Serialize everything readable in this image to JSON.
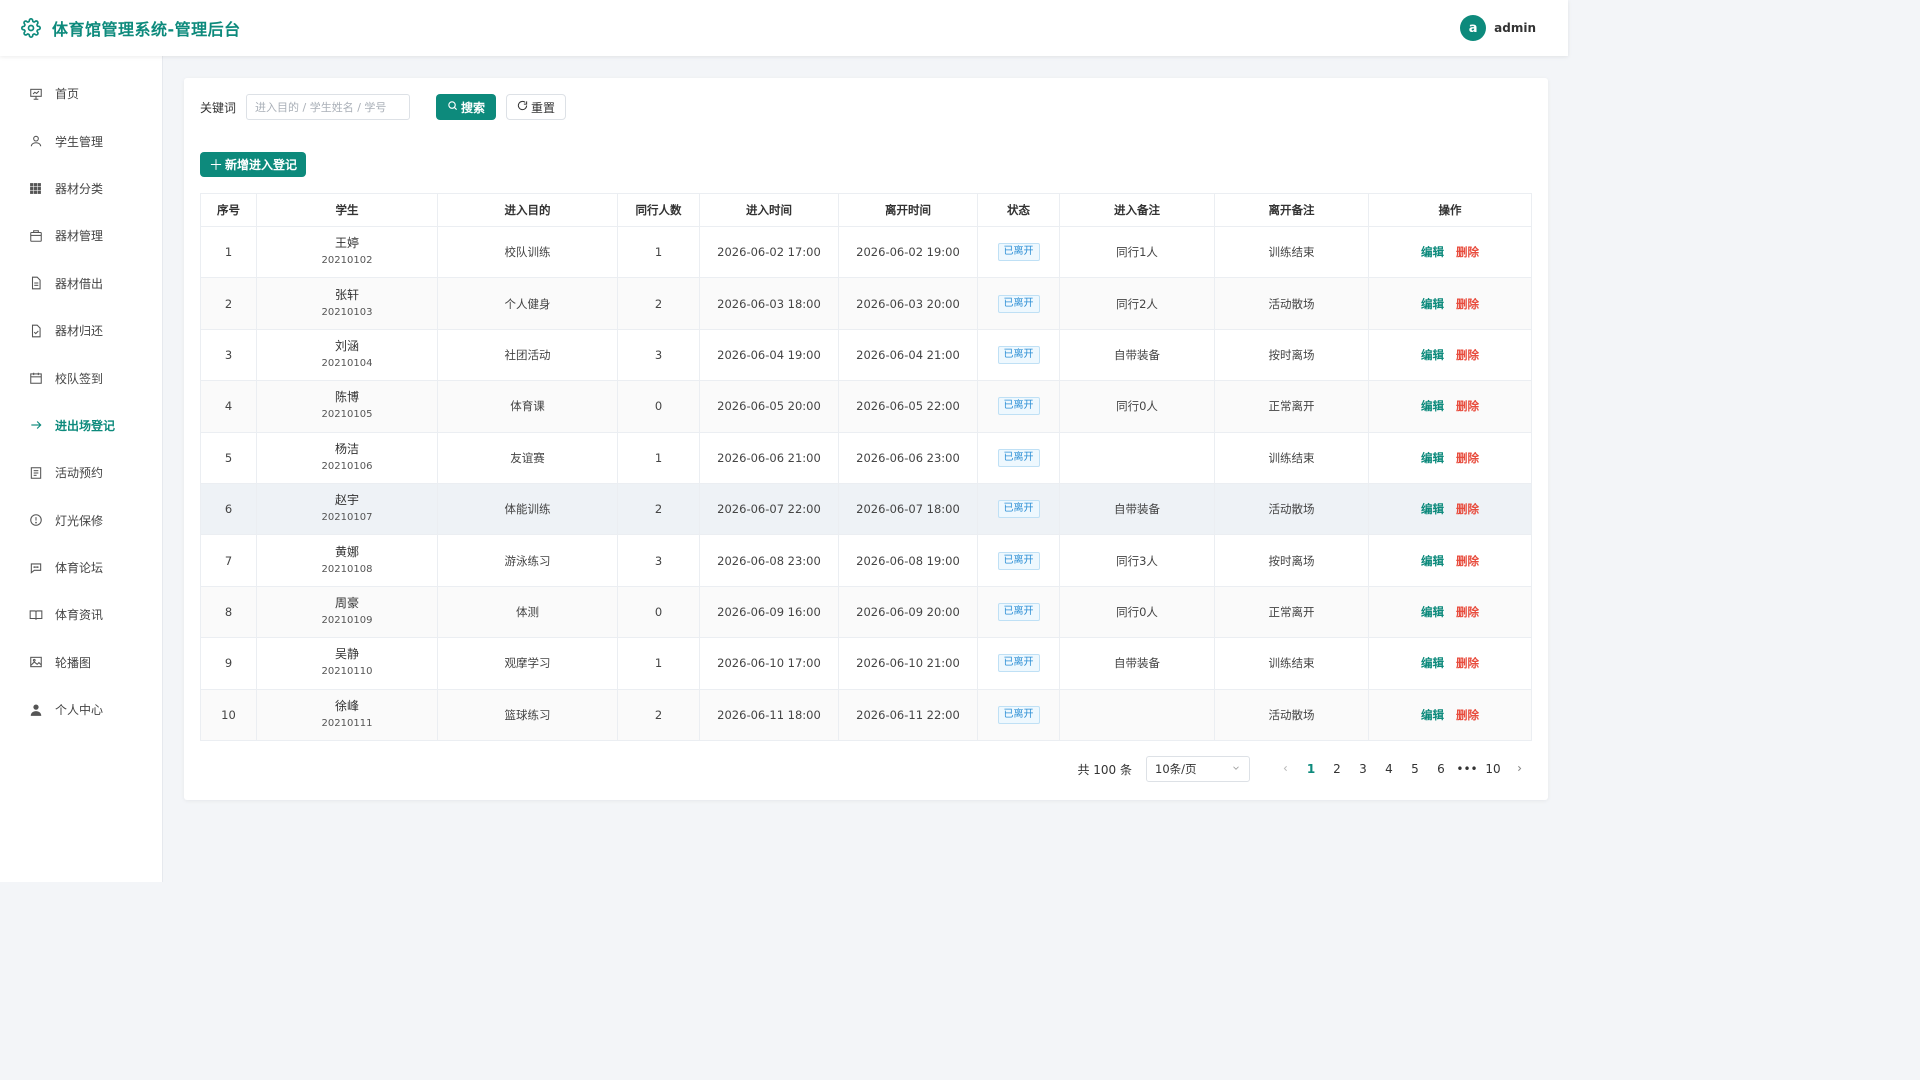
{
  "app": {
    "title": "体育馆管理系统-管理后台"
  },
  "user": {
    "avatar_letter": "a",
    "name": "admin"
  },
  "colors": {
    "primary": "#0d8a7c",
    "danger": "#e84c3d",
    "info": "#2d8fd5"
  },
  "sidebar": {
    "items": [
      {
        "label": "首页",
        "icon": "presentation-icon",
        "active": false
      },
      {
        "label": "学生管理",
        "icon": "user-icon",
        "active": false
      },
      {
        "label": "器材分类",
        "icon": "grid-icon",
        "active": false
      },
      {
        "label": "器材管理",
        "icon": "box-icon",
        "active": false
      },
      {
        "label": "器材借出",
        "icon": "document-icon",
        "active": false
      },
      {
        "label": "器材归还",
        "icon": "document-check-icon",
        "active": false
      },
      {
        "label": "校队签到",
        "icon": "calendar-icon",
        "active": false
      },
      {
        "label": "进出场登记",
        "icon": "arrow-right-icon",
        "active": true
      },
      {
        "label": "活动预约",
        "icon": "list-icon",
        "active": false
      },
      {
        "label": "灯光保修",
        "icon": "warning-icon",
        "active": false
      },
      {
        "label": "体育论坛",
        "icon": "chat-icon",
        "active": false
      },
      {
        "label": "体育资讯",
        "icon": "book-icon",
        "active": false
      },
      {
        "label": "轮播图",
        "icon": "image-icon",
        "active": false
      },
      {
        "label": "个人中心",
        "icon": "person-icon",
        "active": false
      }
    ]
  },
  "search": {
    "label": "关键词",
    "placeholder": "进入目的 / 学生姓名 / 学号",
    "value": "",
    "search_label": "搜索",
    "reset_label": "重置"
  },
  "actions": {
    "add_label": "新增进入登记"
  },
  "table": {
    "columns": [
      "序号",
      "学生",
      "进入目的",
      "同行人数",
      "进入时间",
      "离开时间",
      "状态",
      "进入备注",
      "离开备注",
      "操作"
    ],
    "edit_label": "编辑",
    "delete_label": "删除",
    "rows": [
      {
        "no": "1",
        "name": "王婷",
        "sid": "20210102",
        "purpose": "校队训练",
        "companions": "1",
        "enter": "2026-06-02 17:00",
        "leave": "2026-06-02 19:00",
        "status": "已离开",
        "enter_note": "同行1人",
        "leave_note": "训练结束"
      },
      {
        "no": "2",
        "name": "张轩",
        "sid": "20210103",
        "purpose": "个人健身",
        "companions": "2",
        "enter": "2026-06-03 18:00",
        "leave": "2026-06-03 20:00",
        "status": "已离开",
        "enter_note": "同行2人",
        "leave_note": "活动散场"
      },
      {
        "no": "3",
        "name": "刘涵",
        "sid": "20210104",
        "purpose": "社团活动",
        "companions": "3",
        "enter": "2026-06-04 19:00",
        "leave": "2026-06-04 21:00",
        "status": "已离开",
        "enter_note": "自带装备",
        "leave_note": "按时离场"
      },
      {
        "no": "4",
        "name": "陈博",
        "sid": "20210105",
        "purpose": "体育课",
        "companions": "0",
        "enter": "2026-06-05 20:00",
        "leave": "2026-06-05 22:00",
        "status": "已离开",
        "enter_note": "同行0人",
        "leave_note": "正常离开"
      },
      {
        "no": "5",
        "name": "杨洁",
        "sid": "20210106",
        "purpose": "友谊赛",
        "companions": "1",
        "enter": "2026-06-06 21:00",
        "leave": "2026-06-06 23:00",
        "status": "已离开",
        "enter_note": "",
        "leave_note": "训练结束"
      },
      {
        "no": "6",
        "name": "赵宇",
        "sid": "20210107",
        "purpose": "体能训练",
        "companions": "2",
        "enter": "2026-06-07 22:00",
        "leave": "2026-06-07 18:00",
        "status": "已离开",
        "enter_note": "自带装备",
        "leave_note": "活动散场"
      },
      {
        "no": "7",
        "name": "黄娜",
        "sid": "20210108",
        "purpose": "游泳练习",
        "companions": "3",
        "enter": "2026-06-08 23:00",
        "leave": "2026-06-08 19:00",
        "status": "已离开",
        "enter_note": "同行3人",
        "leave_note": "按时离场"
      },
      {
        "no": "8",
        "name": "周豪",
        "sid": "20210109",
        "purpose": "体测",
        "companions": "0",
        "enter": "2026-06-09 16:00",
        "leave": "2026-06-09 20:00",
        "status": "已离开",
        "enter_note": "同行0人",
        "leave_note": "正常离开"
      },
      {
        "no": "9",
        "name": "吴静",
        "sid": "20210110",
        "purpose": "观摩学习",
        "companions": "1",
        "enter": "2026-06-10 17:00",
        "leave": "2026-06-10 21:00",
        "status": "已离开",
        "enter_note": "自带装备",
        "leave_note": "训练结束"
      },
      {
        "no": "10",
        "name": "徐峰",
        "sid": "20210111",
        "purpose": "篮球练习",
        "companions": "2",
        "enter": "2026-06-11 18:00",
        "leave": "2026-06-11 22:00",
        "status": "已离开",
        "enter_note": "",
        "leave_note": "活动散场"
      }
    ]
  },
  "pagination": {
    "total_text": "共 100 条",
    "page_size": "10条/页",
    "pages": [
      "1",
      "2",
      "3",
      "4",
      "5",
      "6",
      "•••",
      "10"
    ],
    "current": "1"
  }
}
